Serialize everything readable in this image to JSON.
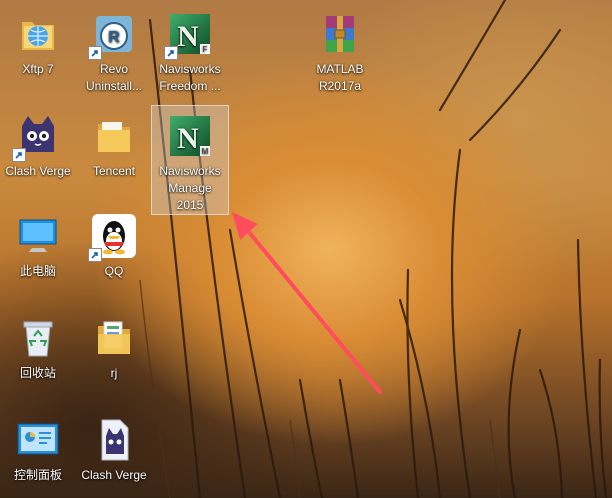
{
  "desktop": {
    "icons": [
      {
        "label": "Xftp 7"
      },
      {
        "label": "Revo Uninstall..."
      },
      {
        "label": "Navisworks Freedom ..."
      },
      {
        "label": "MATLAB R2017a"
      },
      {
        "label": "Clash Verge"
      },
      {
        "label": "Tencent"
      },
      {
        "label": "Navisworks Manage 2015"
      },
      {
        "label": "此电脑"
      },
      {
        "label": "QQ"
      },
      {
        "label": "回收站"
      },
      {
        "label": "rj"
      },
      {
        "label": "控制面板"
      },
      {
        "label": "Clash Verge"
      }
    ]
  },
  "badges": {
    "navis_freedom": "F",
    "navis_manage": "M",
    "navis_letter": "N"
  },
  "colors": {
    "arrow": "#ff4d5e",
    "selection": "#cdd7e6"
  }
}
